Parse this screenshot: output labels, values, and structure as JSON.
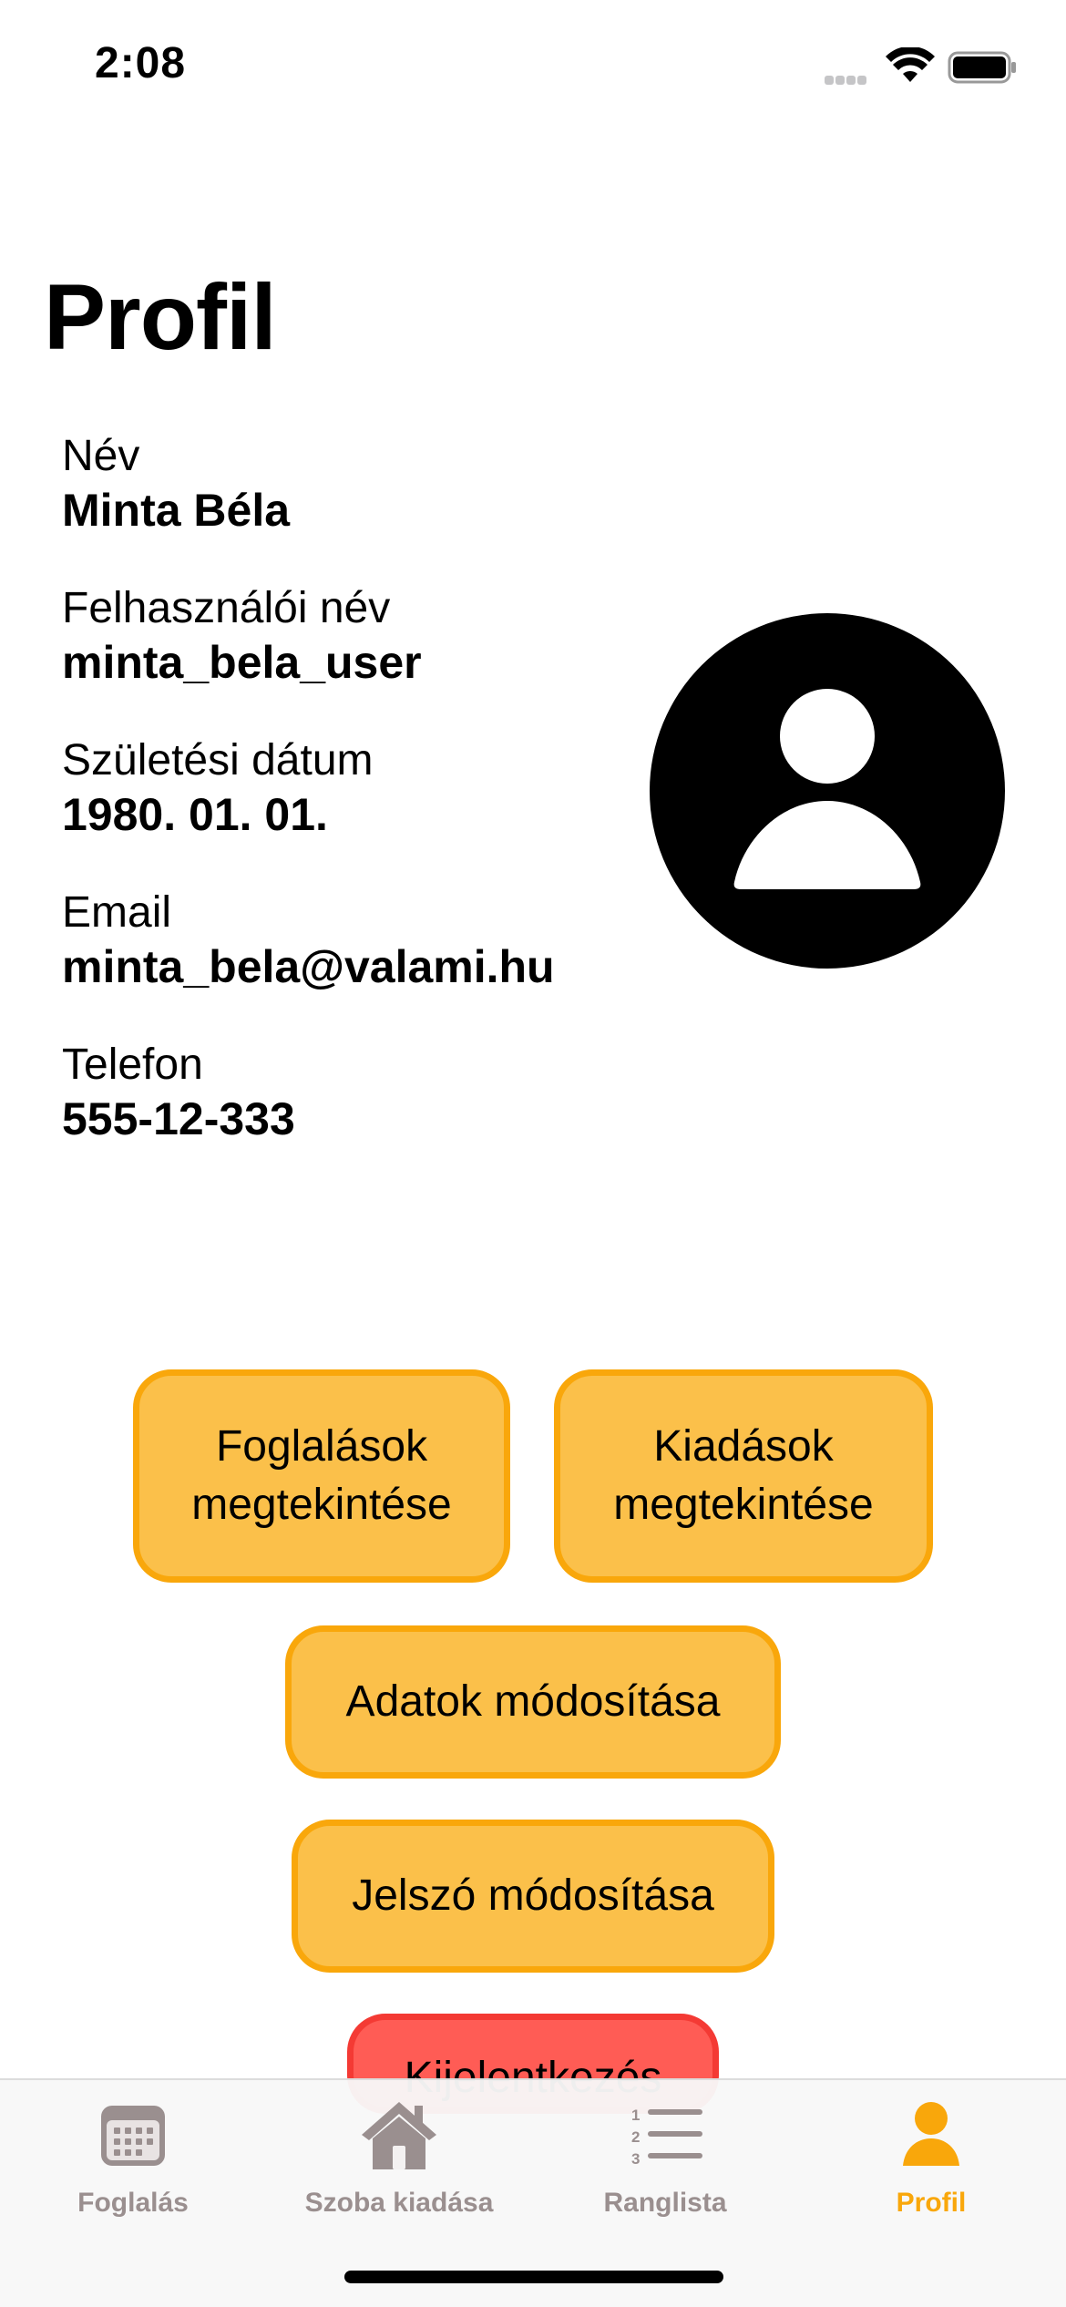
{
  "status_bar": {
    "time": "2:08"
  },
  "title": "Profil",
  "fields": [
    {
      "label": "Név",
      "value": "Minta Béla"
    },
    {
      "label": "Felhasználói név",
      "value": "minta_bela_user"
    },
    {
      "label": "Születési dátum",
      "value": "1980. 01. 01."
    },
    {
      "label": "Email",
      "value": "minta_bela@valami.hu"
    },
    {
      "label": "Telefon",
      "value": "555-12-333"
    }
  ],
  "buttons": {
    "bookings": "Foglalások\nmegtekintése",
    "rentals": "Kiadások\nmegtekintése",
    "edit_data": "Adatok módosítása",
    "change_password": "Jelszó módosítása",
    "logout": "Kijelentkezés"
  },
  "tabs": [
    {
      "label": "Foglalás",
      "icon": "calendar-icon",
      "active": false
    },
    {
      "label": "Szoba kiadása",
      "icon": "house-icon",
      "active": false
    },
    {
      "label": "Ranglista",
      "icon": "numbered-list-icon",
      "active": false
    },
    {
      "label": "Profil",
      "icon": "person-icon",
      "active": true
    }
  ],
  "colors": {
    "accent": "#f9a70b",
    "button_fill": "#fbc04a",
    "logout_fill": "#ff5c55",
    "logout_border": "#f43a34",
    "tab_inactive": "#9a8f8f"
  }
}
